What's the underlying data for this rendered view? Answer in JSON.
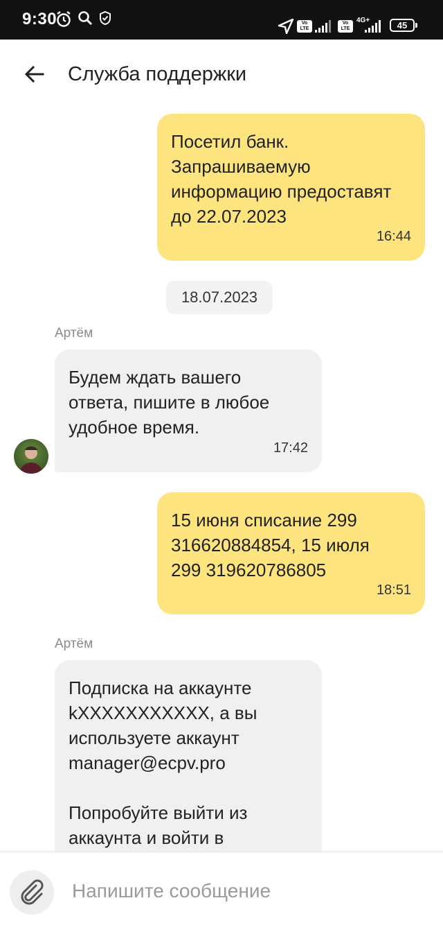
{
  "status_bar": {
    "time": "9:30",
    "network": "4G+",
    "volte": "Vo LTE",
    "battery": "45"
  },
  "header": {
    "title": "Служба поддержки"
  },
  "messages": [
    {
      "from": "me",
      "text_lines": [
        "Посетил банк.",
        "Запрашиваемую",
        "информацию предоставят",
        "до 22.07.2023"
      ],
      "time": "16:44"
    },
    {
      "type": "date",
      "text": "18.07.2023"
    },
    {
      "from": "agent",
      "sender": "Артём",
      "text_lines": [
        "Будем ждать вашего",
        "ответа, пишите в любое",
        "удобное время."
      ],
      "time": "17:42"
    },
    {
      "from": "me",
      "text_lines": [
        "15 июня списание 299",
        "316620884854, 15 июля",
        "299 319620786805"
      ],
      "time": "18:51"
    },
    {
      "from": "agent",
      "sender": "Артём",
      "text_lines": [
        "Подписка на аккаунте",
        "kXXXXXXXXXXX, а вы",
        "используете аккаунт",
        "manager@ecpv.pro",
        "",
        "Попробуйте выйти из",
        "аккаунта и войти в"
      ]
    }
  ],
  "composer": {
    "placeholder": "Напишите сообщение"
  },
  "colors": {
    "my_bubble": "#fde47f",
    "agent_bubble": "#f1f0f0",
    "status_bar": "#121212"
  }
}
